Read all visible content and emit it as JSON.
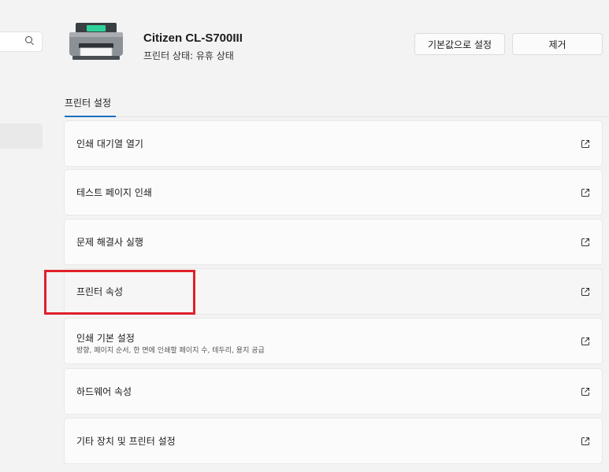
{
  "header": {
    "printer_name": "Citizen CL-S700III",
    "printer_status": "프린터 상태:  유휴 상태",
    "set_default_label": "기본값으로 설정",
    "remove_label": "제거"
  },
  "section": {
    "title": "프린터 설정"
  },
  "rows": [
    {
      "label": "인쇄 대기열 열기"
    },
    {
      "label": "테스트 페이지 인쇄"
    },
    {
      "label": "문제 해결사 실행"
    },
    {
      "label": "프린터 속성"
    },
    {
      "label": "인쇄 기본 설정",
      "sub": "방향, 페이지 순서, 한 면에 인쇄할 페이지 수, 테두리, 용지 공급"
    },
    {
      "label": "하드웨어 속성"
    },
    {
      "label": "기타 장치 및 프린터 설정"
    }
  ],
  "colors": {
    "accent": "#1a6fc2",
    "highlight": "#e0202a"
  },
  "icons": {
    "row_action": "open-external-icon",
    "search": "search-icon",
    "printer": "printer-icon"
  }
}
